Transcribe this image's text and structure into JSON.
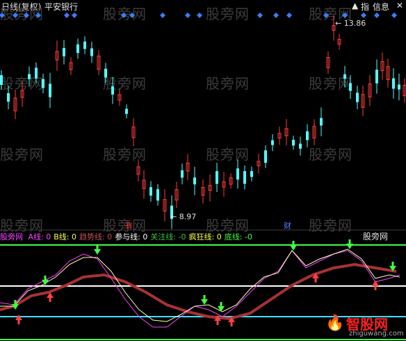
{
  "header": {
    "title": "日线(复权)",
    "stock_name": "平安银行",
    "btn_index": "指",
    "btn_info": "信息",
    "collapse_icon": "triangle-up-icon"
  },
  "watermark": "股旁网",
  "price_labels": {
    "high": "13.86",
    "low": "8.97"
  },
  "markers": {
    "n1": "有",
    "n2": "财"
  },
  "indicator": {
    "name": "股旁网",
    "items": [
      {
        "label": "A线: 0",
        "color": "#ff40ff"
      },
      {
        "label": "B线: 0",
        "color": "#ffff40"
      },
      {
        "label": "趋势线: 0",
        "color": "#c05050"
      },
      {
        "label": "参与线: 0",
        "color": "#ffffff"
      },
      {
        "label": "关注线: -0",
        "color": "#40c040"
      },
      {
        "label": "疯狂线: 0",
        "color": "#ffff40"
      },
      {
        "label": "底线: -0",
        "color": "#40ff40"
      }
    ],
    "panel_tag": "股旁网"
  },
  "logo": {
    "name": "智股网",
    "url": "zhiguwang.com"
  },
  "colors": {
    "up": "#ff3c3c",
    "down": "#54ffff",
    "diamond": "#3c7cff"
  }
}
